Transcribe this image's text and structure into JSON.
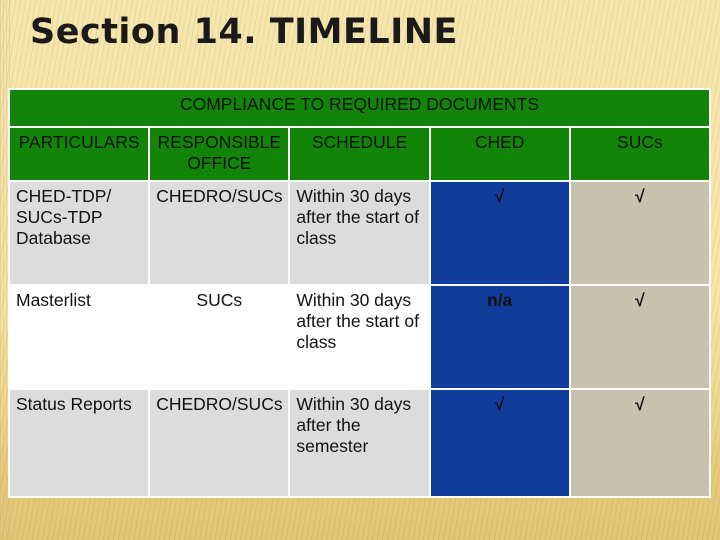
{
  "slide": {
    "title": "Section 14. TIMELINE",
    "background_color": "#f9f0cd",
    "accent_green": "#128508",
    "accent_blue": "#103d9c",
    "accent_tan": "#c8c1ae"
  },
  "table": {
    "banner": "COMPLIANCE TO REQUIRED DOCUMENTS",
    "columns": [
      {
        "label": "PARTICULARS"
      },
      {
        "label": "RESPONSIBLE OFFICE"
      },
      {
        "label": "SCHEDULE"
      },
      {
        "label": "CHED"
      },
      {
        "label": "SUCs"
      }
    ],
    "rows": [
      {
        "particulars": "CHED-TDP/ SUCs-TDP Database",
        "office": "CHEDRO/SUCs",
        "schedule": "Within 30 days after the start of class",
        "ched": "√",
        "sucs": "√"
      },
      {
        "particulars": "Masterlist",
        "office": "SUCs",
        "schedule": "Within 30 days after the start of class",
        "ched": "n/a",
        "sucs": "√"
      },
      {
        "particulars": "Status Reports",
        "office": "CHEDRO/SUCs",
        "schedule": "Within 30 days after the semester",
        "ched": "√",
        "sucs": "√"
      }
    ]
  }
}
